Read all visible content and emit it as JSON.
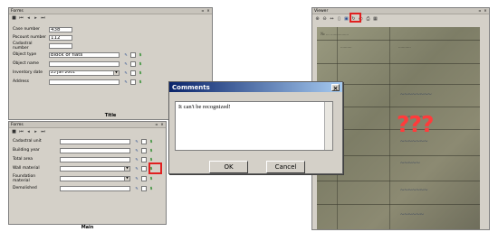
{
  "top_form": {
    "title": "Forms",
    "fields": [
      {
        "label": "Case number",
        "value": "438"
      },
      {
        "label": "Pocount number",
        "value": "112"
      },
      {
        "label": "Cadastral number",
        "value": ""
      },
      {
        "label": "Object type",
        "value": "block of flats"
      },
      {
        "label": "Object name",
        "value": ""
      },
      {
        "label": "Inventory date",
        "value": "25  Jan  2001"
      },
      {
        "label": "Address",
        "value": ""
      }
    ],
    "tab_label": "Title"
  },
  "bottom_form": {
    "title": "Forms",
    "fields": [
      {
        "label": "Cadastral unit"
      },
      {
        "label": "Building year"
      },
      {
        "label": "Total area"
      },
      {
        "label": "Wall material"
      },
      {
        "label": "Foundation material"
      },
      {
        "label": "Demolished"
      }
    ],
    "tab_label": "Main"
  },
  "dialog": {
    "title": "Comments",
    "text": "It can't be recognized!",
    "ok_label": "OK",
    "cancel_label": "Cancel"
  },
  "viewer": {
    "title": "Viewer",
    "overlay_text": "???",
    "overlay_color": "#ff3b3b"
  },
  "highlight_color": "#e02020"
}
